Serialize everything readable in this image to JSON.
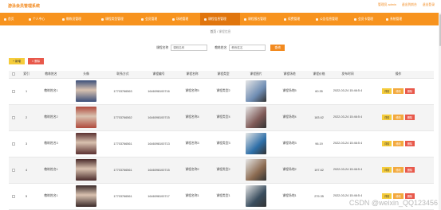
{
  "header": {
    "brand": "游泳会员管理系统",
    "user_links": [
      "管理员 admin",
      "退出到前台",
      "退出登录"
    ]
  },
  "nav": {
    "items": [
      {
        "label": "首页",
        "icon": "home-icon",
        "active": false
      },
      {
        "label": "个人中心",
        "icon": "user-icon",
        "active": false
      },
      {
        "label": "教练员管理",
        "icon": "coach-icon",
        "active": false
      },
      {
        "label": "课程类型管理",
        "icon": "category-icon",
        "active": false
      },
      {
        "label": "会员管理",
        "icon": "member-icon",
        "active": false
      },
      {
        "label": "场地管理",
        "icon": "place-icon",
        "active": false
      },
      {
        "label": "课程信息管理",
        "icon": "course-icon",
        "active": true
      },
      {
        "label": "课程报名管理",
        "icon": "signup-icon",
        "active": false
      },
      {
        "label": "续费管理",
        "icon": "renew-icon",
        "active": false
      },
      {
        "label": "公告信息管理",
        "icon": "notice-icon",
        "active": false
      },
      {
        "label": "会员卡管理",
        "icon": "card-icon",
        "active": false
      },
      {
        "label": "系统管理",
        "icon": "system-icon",
        "active": false
      }
    ]
  },
  "breadcrumb": {
    "home": "首页",
    "sep": "/",
    "current": "课程信息"
  },
  "search": {
    "label1": "课程名称",
    "placeholder1": "课程名称",
    "label2": "教练姓名",
    "placeholder2": "教练姓名",
    "button": "查询"
  },
  "actions": {
    "add": "新增",
    "delete": "删除"
  },
  "table": {
    "headers": [
      "索引",
      "教练姓名",
      "头像",
      "联系方式",
      "课程编号",
      "课程名称",
      "课程类型",
      "课程图片",
      "课程场地",
      "课程价格",
      "发布时间",
      "操作"
    ],
    "rows": [
      {
        "index": "1",
        "coach": "教练姓名1",
        "phone": "17703766563",
        "code": "1646098100716",
        "name": "课程名称5",
        "type": "课程类型2",
        "place": "课程场地5",
        "price": "60.35",
        "time": "2022-03-24 15:46:5 4",
        "avatar": "#3b4f7a",
        "img": "#6f8db3"
      },
      {
        "index": "2",
        "coach": "教练姓名2",
        "phone": "17703766562",
        "code": "1646098100715",
        "name": "课程名称4",
        "type": "课程类型4",
        "place": "课程场地4",
        "price": "183.62",
        "time": "2022-03-24 15:46:5 4",
        "avatar": "#b04a3c",
        "img": "#7f5a57"
      },
      {
        "index": "3",
        "coach": "教练姓名3",
        "phone": "17703766561",
        "code": "1646098100713",
        "name": "课程名称3",
        "type": "课程类型3",
        "place": "课程场地3",
        "price": "96.19",
        "time": "2022-03-24 15:46:5 4",
        "avatar": "#5a3030",
        "img": "#2e6fa8"
      },
      {
        "index": "4",
        "coach": "教练姓名1",
        "phone": "17703766561",
        "code": "1646098100715",
        "name": "课程名称2",
        "type": "课程类型2",
        "place": "课程场地2",
        "price": "197.62",
        "time": "2022-03-24 15:46:5 4",
        "avatar": "#4a2b2b",
        "img": "#8b6a50"
      },
      {
        "index": "5",
        "coach": "教练姓名1",
        "phone": "17703766561",
        "code": "1646098100717",
        "name": "课程名称1",
        "type": "课程类型1",
        "place": "课程场地1",
        "price": "279.35",
        "time": "2022-03-24 15:46:5 4",
        "avatar": "#3a2a2a",
        "img": "#3a4e5f"
      }
    ],
    "op_detail": "详情",
    "op_edit": "修改",
    "op_delete": "删除"
  },
  "watermark": "CSDN @weixin_QQ123456"
}
